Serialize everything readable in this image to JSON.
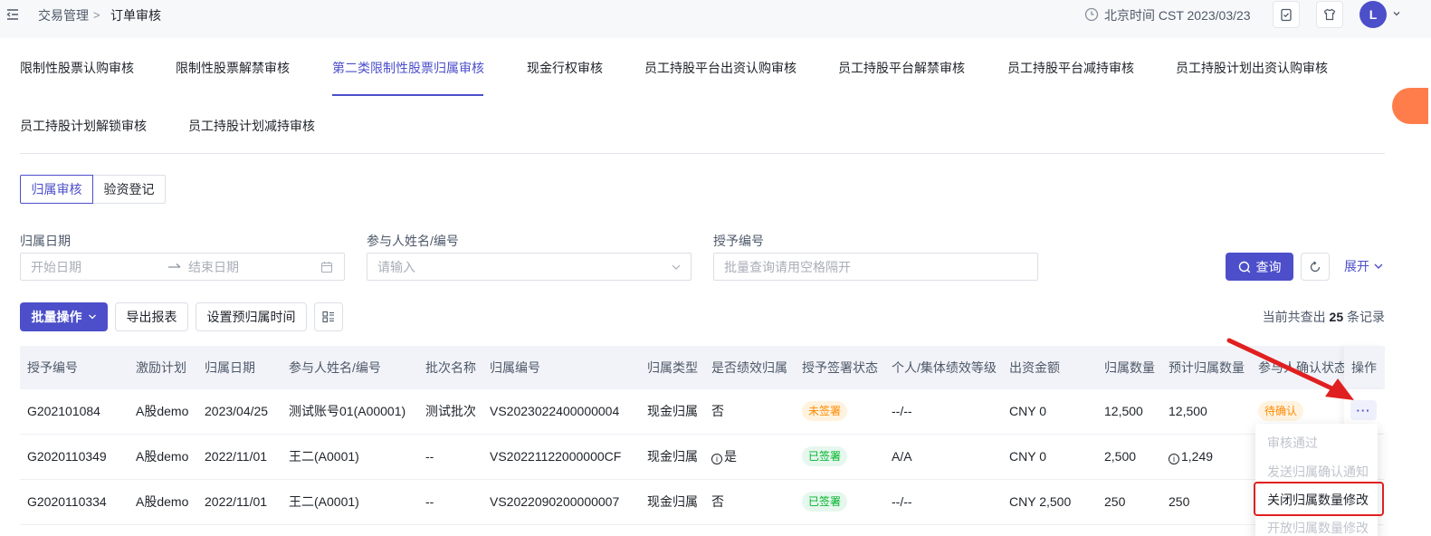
{
  "topbar": {
    "breadcrumb_parent": "交易管理",
    "breadcrumb_separator": ">",
    "breadcrumb_current": "订单审核",
    "time_text": "北京时间 CST 2023/03/23",
    "avatar_letter": "L"
  },
  "tabs": [
    {
      "label": "限制性股票认购审核"
    },
    {
      "label": "限制性股票解禁审核"
    },
    {
      "label": "第二类限制性股票归属审核",
      "active": true
    },
    {
      "label": "现金行权审核"
    },
    {
      "label": "员工持股平台出资认购审核"
    },
    {
      "label": "员工持股平台解禁审核"
    },
    {
      "label": "员工持股平台减持审核"
    },
    {
      "label": "员工持股计划出资认购审核"
    },
    {
      "label": "员工持股计划解锁审核"
    },
    {
      "label": "员工持股计划减持审核"
    }
  ],
  "segments": [
    {
      "label": "归属审核",
      "active": true
    },
    {
      "label": "验资登记"
    }
  ],
  "filters": {
    "date_label": "归属日期",
    "start_placeholder": "开始日期",
    "end_placeholder": "结束日期",
    "participant_label": "参与人姓名/编号",
    "participant_placeholder": "请输入",
    "grant_label": "授予编号",
    "grant_placeholder": "批量查询请用空格隔开",
    "query_button": "查询",
    "expand_label": "展开"
  },
  "actions": {
    "batch_button": "批量操作",
    "export_button": "导出报表",
    "set_time_button": "设置预归属时间",
    "count_prefix": "当前共查出",
    "count_value": "25",
    "count_suffix": "条记录"
  },
  "table": {
    "columns": [
      "授予编号",
      "激励计划",
      "归属日期",
      "参与人姓名/编号",
      "批次名称",
      "归属编号",
      "归属类型",
      "是否绩效归属",
      "授予签署状态",
      "个人/集体绩效等级",
      "出资金额",
      "归属数量",
      "预计归属数量",
      "参与人确认状态",
      "操作"
    ],
    "rows": [
      {
        "grant_no": "G202101084",
        "plan": "A股demo",
        "date": "2023/04/25",
        "participant": "测试账号01(A00001)",
        "batch": "测试批次",
        "vest_no": "VS2023022400000004",
        "type": "现金归属",
        "perf": "否",
        "sign_status": "未签署",
        "grade": "--/--",
        "amount": "CNY 0",
        "qty": "12,500",
        "est_qty": "12,500",
        "confirm_status": "待确认"
      },
      {
        "grant_no": "G2020110349",
        "plan": "A股demo",
        "date": "2022/11/01",
        "participant": "王二(A0001)",
        "batch": "--",
        "vest_no": "VS20221122000000CF",
        "type": "现金归属",
        "perf": "是",
        "sign_status": "已签署",
        "grade": "A/A",
        "amount": "CNY 0",
        "qty": "2,500",
        "est_qty": "1,249",
        "confirm_status": ""
      },
      {
        "grant_no": "G2020110334",
        "plan": "A股demo",
        "date": "2022/11/01",
        "participant": "王二(A0001)",
        "batch": "--",
        "vest_no": "VS2022090200000007",
        "type": "现金归属",
        "perf": "否",
        "sign_status": "已签署",
        "grade": "--/--",
        "amount": "CNY 2,500",
        "qty": "250",
        "est_qty": "250",
        "confirm_status": ""
      }
    ],
    "more_label": "···"
  },
  "dropdown": {
    "items": [
      {
        "label": "审核通过",
        "disabled": true
      },
      {
        "label": "发送归属确认通知",
        "disabled": true
      },
      {
        "label": "关闭归属数量修改",
        "disabled": false
      },
      {
        "label": "开放归属数量修改",
        "disabled": true
      }
    ]
  },
  "colors": {
    "primary": "#4c4fc9",
    "annotation_red": "#e02020",
    "tag_orange": "#ff8a00",
    "tag_green": "#00b42a"
  }
}
